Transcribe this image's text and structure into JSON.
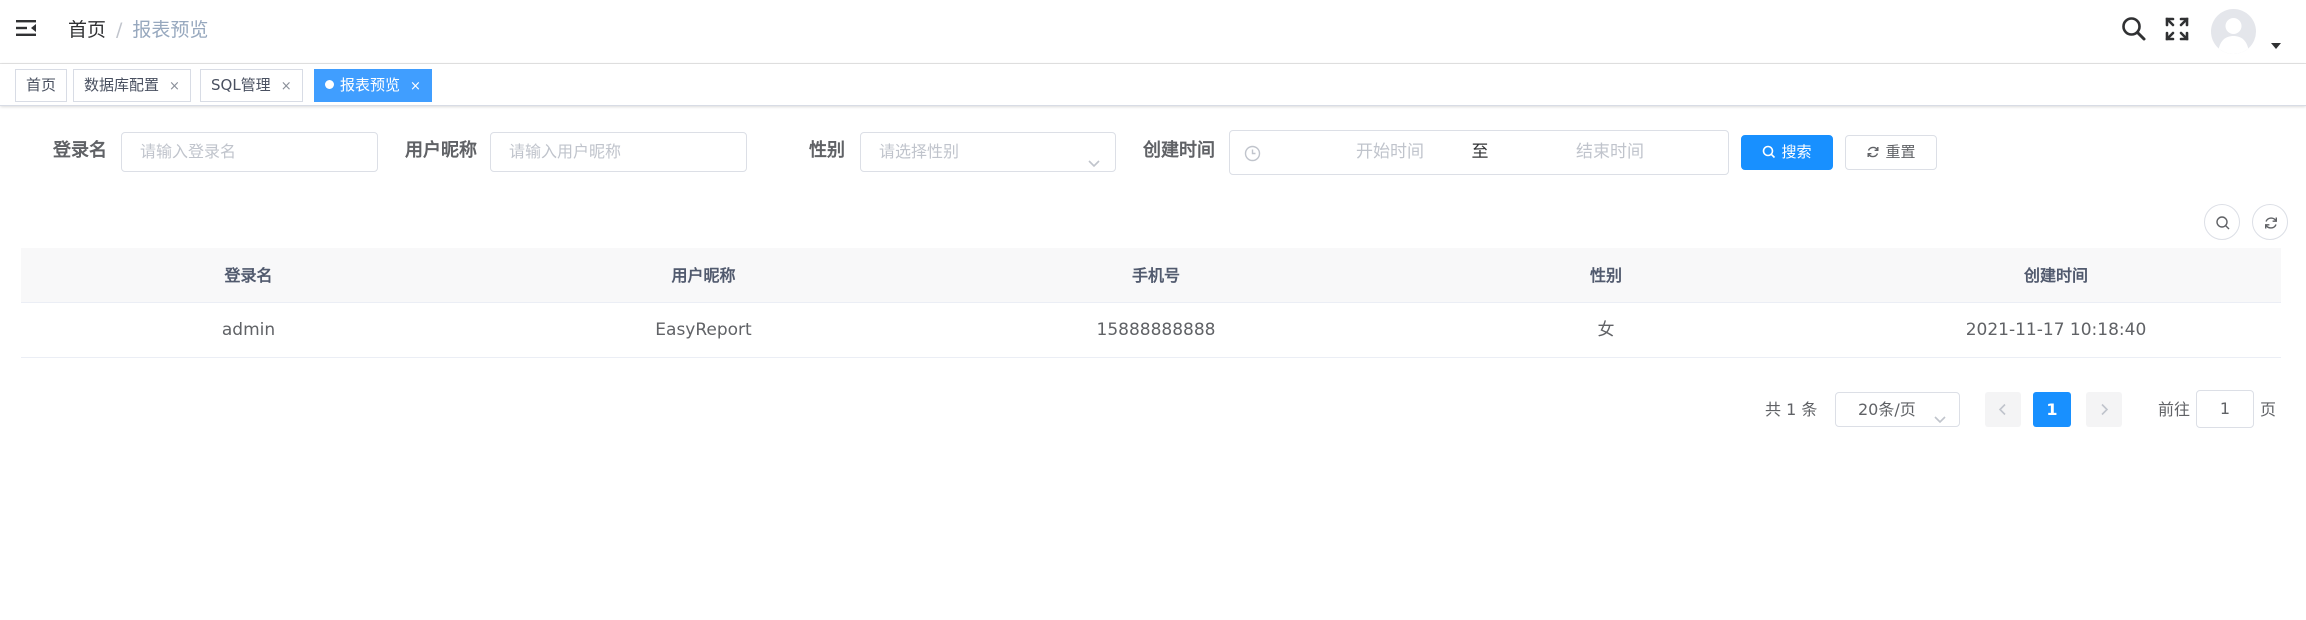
{
  "breadcrumb": {
    "home": "首页",
    "separator": "/",
    "current": "报表预览"
  },
  "navbar": {
    "icons": [
      "menu-fold-icon",
      "search-icon",
      "fullscreen-icon",
      "user-avatar",
      "caret-down-icon"
    ]
  },
  "tags": [
    {
      "label": "首页",
      "closable": false,
      "active": false
    },
    {
      "label": "数据库配置",
      "closable": true,
      "active": false
    },
    {
      "label": "SQL管理",
      "closable": true,
      "active": false
    },
    {
      "label": "报表预览",
      "closable": true,
      "active": true
    }
  ],
  "tag_close_glyph": "×",
  "search_form": {
    "login_name": {
      "label": "登录名",
      "placeholder": "请输入登录名"
    },
    "nickname": {
      "label": "用户昵称",
      "placeholder": "请输入用户昵称"
    },
    "gender": {
      "label": "性别",
      "placeholder": "请选择性别"
    },
    "created_time": {
      "label": "创建时间",
      "start_placeholder": "开始时间",
      "separator": "至",
      "end_placeholder": "结束时间"
    },
    "search_button": "搜索",
    "reset_button": "重置"
  },
  "table": {
    "columns": [
      "登录名",
      "用户昵称",
      "手机号",
      "性别",
      "创建时间"
    ],
    "rows": [
      [
        "admin",
        "EasyReport",
        "15888888888",
        "女",
        "2021-11-17 10:18:40"
      ]
    ]
  },
  "pagination": {
    "total_text": "共 1 条",
    "page_size": "20条/页",
    "current_page": "1",
    "goto_label": "前往",
    "goto_value": "1",
    "goto_suffix": "页"
  },
  "colors": {
    "primary": "#1890ff",
    "active_tag": "#409eff",
    "header_bg": "#f8f8f9"
  }
}
